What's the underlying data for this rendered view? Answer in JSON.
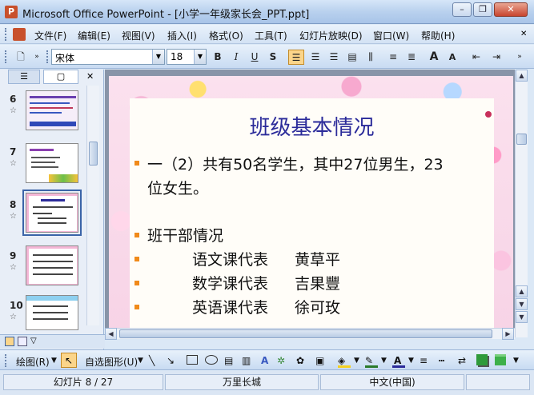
{
  "window": {
    "title": "Microsoft Office PowerPoint - [小学一年级家长会_PPT.ppt]",
    "app_icon_letter": "P",
    "minimize": "–",
    "restore": "❐",
    "close": "✕"
  },
  "menu": [
    {
      "label": "文件(F)"
    },
    {
      "label": "编辑(E)"
    },
    {
      "label": "视图(V)"
    },
    {
      "label": "插入(I)"
    },
    {
      "label": "格式(O)"
    },
    {
      "label": "工具(T)"
    },
    {
      "label": "幻灯片放映(D)"
    },
    {
      "label": "窗口(W)"
    },
    {
      "label": "帮助(H)"
    }
  ],
  "toolbar": {
    "font_name": "宋体",
    "font_size": "18",
    "bold": "B",
    "italic": "I",
    "underline": "U",
    "shadow": "S",
    "increase_font": "A",
    "decrease_font": "A"
  },
  "left_panel": {
    "tab_outline": "☰",
    "tab_slides": "▢",
    "close": "✕",
    "thumbnails": [
      {
        "num": "6",
        "star": "☆"
      },
      {
        "num": "7",
        "star": "☆"
      },
      {
        "num": "8",
        "star": "☆"
      },
      {
        "num": "9",
        "star": "☆"
      },
      {
        "num": "10",
        "star": "☆"
      }
    ]
  },
  "slide": {
    "title": "班级基本情况",
    "line1a": "一（2）共有50名学生，其中27位男生，23",
    "line1b": "位女生。",
    "line2": "班干部情况",
    "roles": [
      {
        "role": "语文课代表",
        "name": "黄草平"
      },
      {
        "role": "数学课代表",
        "name": "吉果豐"
      },
      {
        "role": "英语课代表",
        "name": "徐可玫"
      }
    ]
  },
  "drawing_toolbar": {
    "draw_label": "绘图(R)",
    "autoshape_label": "自选图形(U)"
  },
  "status": {
    "slide_counter": "幻灯片 8 / 27",
    "design": "万里长城",
    "language": "中文(中国)"
  },
  "colors": {
    "title_blue": "#2b2b9a",
    "bullet_orange": "#f08a1a",
    "accent_selected": "#3b64a8"
  }
}
